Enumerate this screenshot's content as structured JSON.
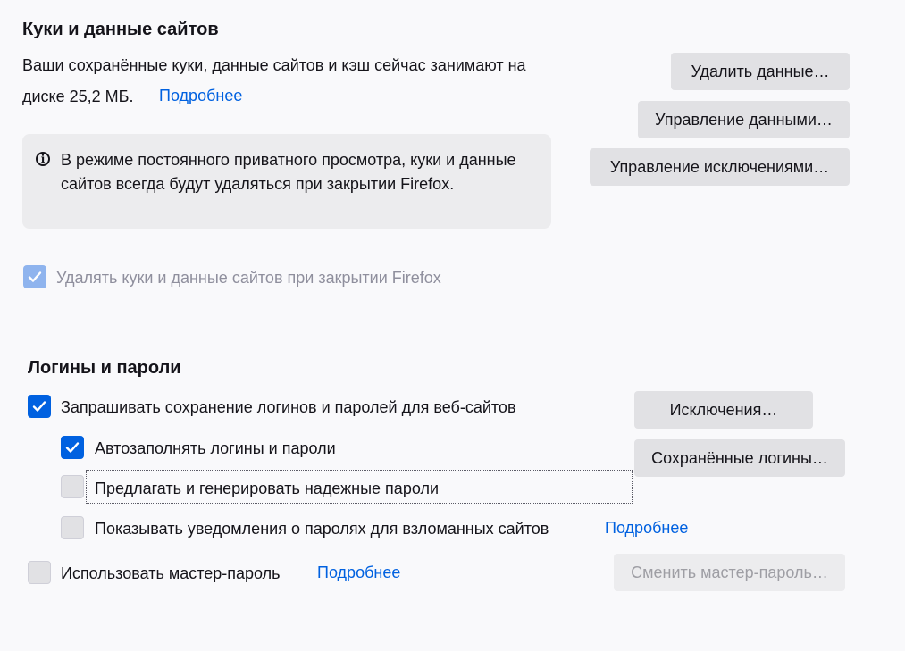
{
  "cookies": {
    "heading": "Куки и данные сайтов",
    "usage_line1": "Ваши сохранённые куки, данные сайтов и кэш сейчас занимают на",
    "usage_line2": "диске 25,2 МБ.",
    "learn_more": "Подробнее",
    "clear_data_button": "Удалить данные…",
    "manage_data_button": "Управление данными…",
    "manage_exceptions_button": "Управление исключениями…",
    "info_text": "В режиме постоянного приватного просмотра, куки и данные сайтов всегда будут удаляться при закрытии Firefox.",
    "delete_on_close_label": "Удалять куки и данные сайтов при закрытии Firefox",
    "delete_on_close_checked": true,
    "delete_on_close_disabled": true
  },
  "logins": {
    "heading": "Логины и пароли",
    "ask_to_save_label": "Запрашивать сохранение логинов и паролей для веб-сайтов",
    "ask_to_save_checked": true,
    "autofill_label": "Автозаполнять логины и пароли",
    "autofill_checked": true,
    "suggest_label": "Предлагать и генерировать надежные пароли",
    "suggest_checked": false,
    "breach_alerts_label": "Показывать уведомления о паролях для взломанных сайтов",
    "breach_alerts_checked": false,
    "breach_learn_more": "Подробнее",
    "master_password_label": "Использовать мастер-пароль",
    "master_password_checked": false,
    "master_learn_more": "Подробнее",
    "exceptions_button": "Исключения…",
    "saved_logins_button": "Сохранённые логины…",
    "change_master_button": "Сменить мастер-пароль…",
    "change_master_disabled": true
  },
  "colors": {
    "accent": "#0061e0",
    "checkbox_disabled_checked": "#8fb4ee",
    "button_bg": "#e1e1e4",
    "infobox_bg": "#ececee"
  },
  "icons": {
    "info": "info-icon",
    "checkmark": "checkmark-icon"
  }
}
